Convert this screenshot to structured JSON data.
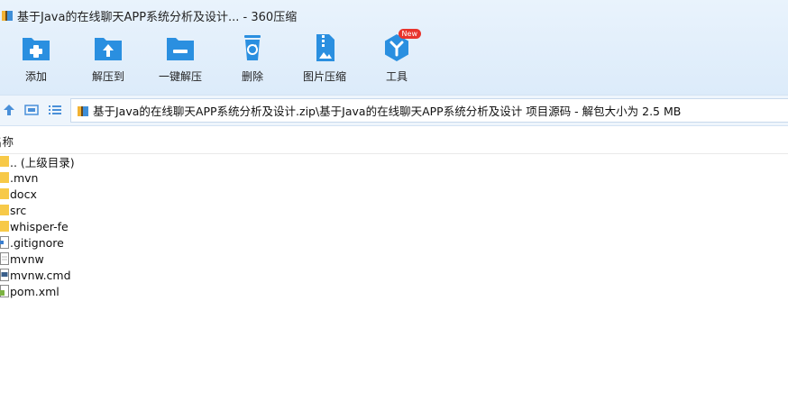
{
  "window": {
    "title": "基于Java的在线聊天APP系统分析及设计...  - 360压缩"
  },
  "toolbar": {
    "items": [
      {
        "label": "添加",
        "icon": "add-folder-icon"
      },
      {
        "label": "解压到",
        "icon": "extract-to-icon"
      },
      {
        "label": "一键解压",
        "icon": "one-click-extract-icon"
      },
      {
        "label": "删除",
        "icon": "recycle-bin-icon"
      },
      {
        "label": "图片压缩",
        "icon": "image-compress-icon"
      },
      {
        "label": "工具",
        "icon": "tools-icon",
        "badge": "New"
      }
    ]
  },
  "address_bar": {
    "path": "基于Java的在线聊天APP系统分析及设计.zip\\基于Java的在线聊天APP系统分析及设计 项目源码 - 解包大小为 2.5 MB"
  },
  "file_list": {
    "column_name": "名称",
    "items": [
      {
        "name": ".. (上级目录)",
        "type": "folder"
      },
      {
        "name": ".mvn",
        "type": "folder"
      },
      {
        "name": "docx",
        "type": "folder"
      },
      {
        "name": "src",
        "type": "folder"
      },
      {
        "name": "whisper-fe",
        "type": "folder"
      },
      {
        "name": ".gitignore",
        "type": "file"
      },
      {
        "name": "mvnw",
        "type": "file"
      },
      {
        "name": "mvnw.cmd",
        "type": "cmd-file"
      },
      {
        "name": "pom.xml",
        "type": "xml-file"
      }
    ]
  },
  "colors": {
    "accent": "#2a8fe0",
    "toolbar_bg": "#e3effb",
    "folder": "#f7c948",
    "badge": "#e8342c"
  }
}
